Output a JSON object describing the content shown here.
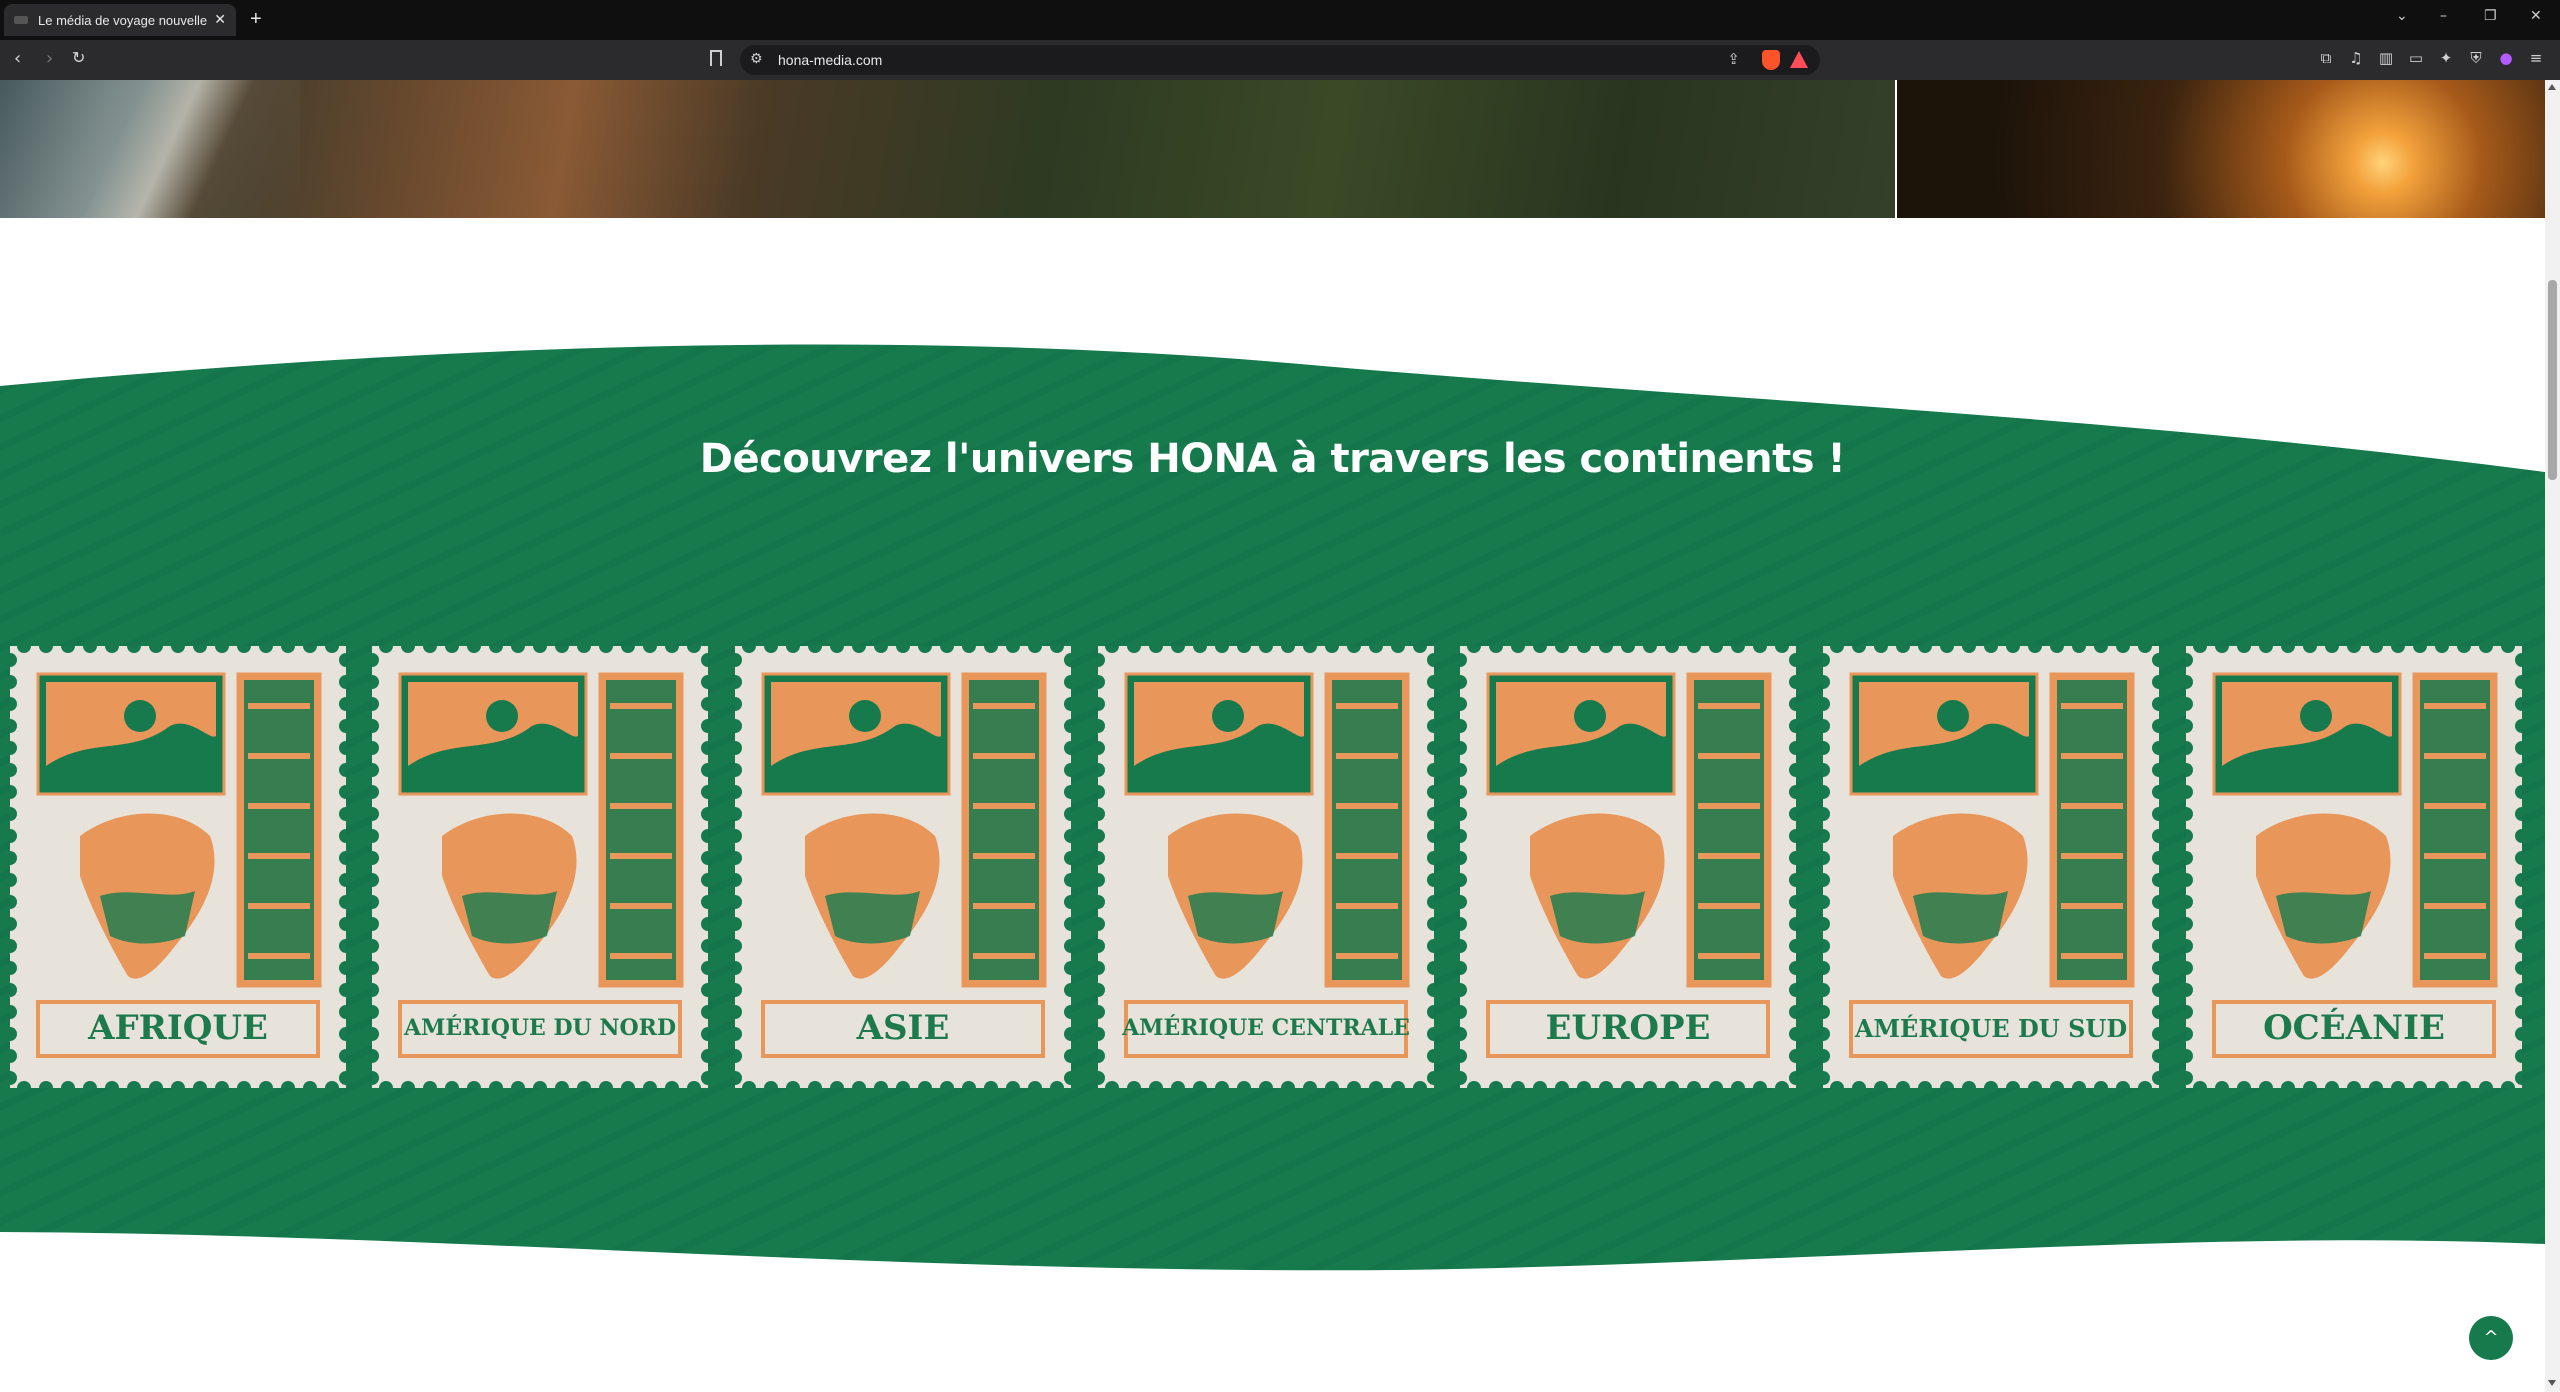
{
  "browser": {
    "tab_title": "Le média de voyage nouvelle g",
    "new_tab": "+",
    "url": "hona-media.com",
    "controls": {
      "dropdown": "⌄",
      "minimize": "–",
      "restore": "❐",
      "close": "✕"
    }
  },
  "section": {
    "heading": "Découvrez l'univers HONA à travers les continents !",
    "continents": [
      {
        "label": "AFRIQUE"
      },
      {
        "label": "AMÉRIQUE DU NORD"
      },
      {
        "label": "ASIE"
      },
      {
        "label": "AMÉRIQUE CENTRALE"
      },
      {
        "label": "EUROPE"
      },
      {
        "label": "AMÉRIQUE DU SUD"
      },
      {
        "label": "OCÉANIE"
      }
    ]
  },
  "scroll_top": {
    "icon": "^"
  },
  "colors": {
    "green": "#167a4d",
    "orange": "#e8965a",
    "paper": "#e7e3da"
  }
}
